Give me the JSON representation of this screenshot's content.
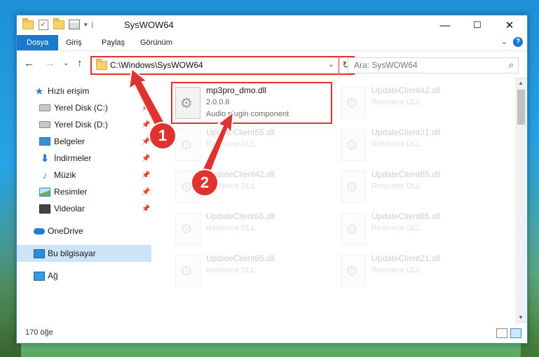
{
  "window": {
    "title": "SysWOW64",
    "minimize": "—",
    "maximize": "☐",
    "close": "✕"
  },
  "ribbon": {
    "tabs": [
      "Dosya",
      "Giriş",
      "Paylaş",
      "Görünüm"
    ],
    "help": "?"
  },
  "address": {
    "path": "C:\\Windows\\SysWOW64"
  },
  "search": {
    "placeholder": "Ara: SysWOW64"
  },
  "sidebar": {
    "items": [
      {
        "label": "Hızlı erişim",
        "icon": "star-icon"
      },
      {
        "label": "Yerel Disk (C:)",
        "icon": "drive-icon"
      },
      {
        "label": "Yerel Disk (D:)",
        "icon": "drive-icon"
      },
      {
        "label": "Belgeler",
        "icon": "documents-icon"
      },
      {
        "label": "İndirmeler",
        "icon": "download-icon"
      },
      {
        "label": "Müzik",
        "icon": "music-icon"
      },
      {
        "label": "Resimler",
        "icon": "pictures-icon"
      },
      {
        "label": "Videolar",
        "icon": "video-icon"
      },
      {
        "label": "OneDrive",
        "icon": "cloud-icon"
      },
      {
        "label": "Bu bilgisayar",
        "icon": "computer-icon"
      },
      {
        "label": "Ağ",
        "icon": "network-icon"
      }
    ]
  },
  "files": {
    "main": {
      "name": "mp3pro_dmo.dll",
      "version": "2.0.0.6",
      "desc": "Audio plugin component"
    },
    "ghosts": [
      {
        "name": "UpdateClient42.dll",
        "desc": "Resource DLL"
      },
      {
        "name": "UpdateClient65.dll",
        "desc": "Resource DLL"
      },
      {
        "name": "UpdateClient21.dll",
        "desc": "Resource DLL"
      },
      {
        "name": "UpdateClient42.dll",
        "desc": "Resource DLL"
      },
      {
        "name": "UpdateClient65.dll",
        "desc": "Resource DLL"
      },
      {
        "name": "UpdateClient65.dll",
        "desc": "Resource DLL"
      },
      {
        "name": "UpdateClient65.dll",
        "desc": "Resource DLL"
      },
      {
        "name": "UpdateClient65.dll",
        "desc": "Resource DLL"
      },
      {
        "name": "UpdateClient21.dll",
        "desc": "Resource DLL"
      }
    ]
  },
  "status": {
    "count": "170 öğe"
  },
  "annotations": {
    "badge1": "1",
    "badge2": "2",
    "color": "#e0322e"
  }
}
